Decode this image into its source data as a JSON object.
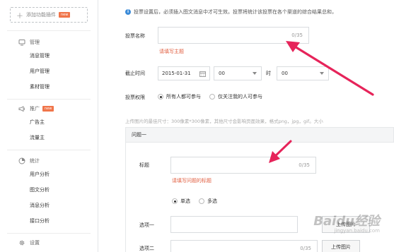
{
  "sidebar": {
    "add_plugin": "添加功能插件",
    "new_badge": "new",
    "sections": [
      {
        "icon": "monitor-icon",
        "title": "管理",
        "items": [
          "消息管理",
          "用户管理",
          "素材管理"
        ]
      },
      {
        "icon": "megaphone-icon",
        "title": "推广",
        "badge": "new",
        "items": [
          "广告主",
          "流量主"
        ]
      },
      {
        "icon": "chart-icon",
        "title": "统计",
        "items": [
          "用户分析",
          "图文分析",
          "消息分析",
          "接口分析"
        ]
      },
      {
        "icon": "gear-icon",
        "title": "设置",
        "items": []
      }
    ]
  },
  "main": {
    "notice": "投票设置后，必须插入图文消息中才可生效。投票将统计该投票在各个渠道的综合结果总和，",
    "vote_name_label": "投票名称",
    "vote_name_counter": "0/35",
    "vote_name_error": "请填写主题",
    "deadline_label": "截止时间",
    "deadline_date": "2015-01-31",
    "hour_value": "00",
    "hour_unit": "时",
    "minute_value": "00",
    "permission_label": "投票权限",
    "permission_options": [
      "所有人都可参与",
      "仅关注我的人可参与"
    ],
    "image_hint": "上传图片的最佳尺寸：300像素*300像素，其他尺寸会影响页面效果，格式png，jpg，gif。大小",
    "question_title": "问题一",
    "title_label": "标题",
    "title_counter": "0/35",
    "title_error": "请填写问题的标题",
    "type_options": [
      "单选",
      "多选"
    ],
    "option1_label": "选项一",
    "option2_label": "选项二",
    "option_counter": "0/35",
    "upload_label": "上传图片"
  },
  "watermark": {
    "brand": "Baidu经验",
    "url": "jingyan.baidu.com"
  },
  "colors": {
    "accent": "#3b8bd8",
    "error": "#e15f41",
    "arrow": "#e6245a",
    "new_badge": "#f0754a"
  }
}
